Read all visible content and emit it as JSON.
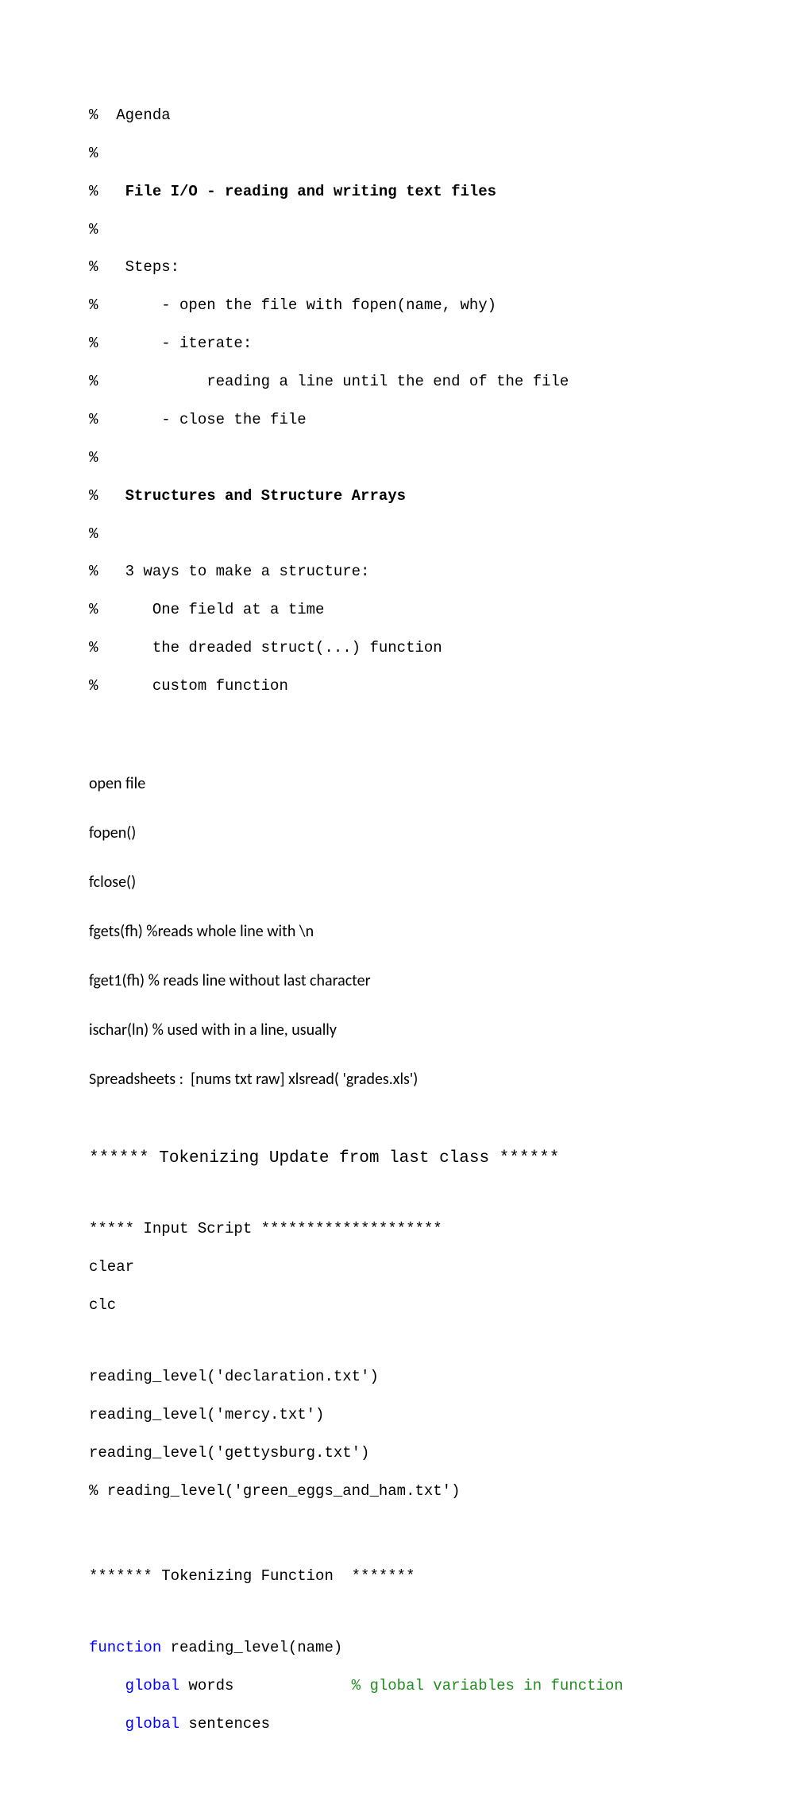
{
  "agenda": {
    "l1": "%  Agenda",
    "l2": "%",
    "l3_pre": "%   ",
    "l3_bold": "File I/O - reading and writing text files",
    "l4": "%",
    "l5": "%   Steps:",
    "l6": "%       - open the file with fopen(name, why)",
    "l7": "%       - iterate:",
    "l8": "%            reading a line until the end of the file",
    "l9": "%       - close the file",
    "l10": "%",
    "l11_pre": "%   ",
    "l11_bold": "Structures and Structure Arrays",
    "l12": "%",
    "l13": "%   3 ways to make a structure:",
    "l14": "%      One field at a time",
    "l15": "%      the dreaded struct(...) function",
    "l16": "%      custom function"
  },
  "notes": {
    "n1": "open file",
    "n2": "fopen()",
    "n3": "fclose()",
    "n4": "fgets(fh) %reads whole line with \\n",
    "n5": "fget1(fh) % reads line without last character",
    "n6": "ischar(ln) % used with in a line, usually",
    "n7": "Spreadsheets :  [nums txt raw] xlsread( 'grades.xls')"
  },
  "sections": {
    "tok_update": "****** Tokenizing Update from last class ******",
    "input_script": "***** Input Script ********************",
    "tok_func": "******* Tokenizing Function  *******"
  },
  "script": {
    "s1": "clear",
    "s2": "clc",
    "s3": "reading_level('declaration.txt')",
    "s4": "reading_level('mercy.txt')",
    "s5": "reading_level('gettysburg.txt')",
    "s6": "% reading_level('green_eggs_and_ham.txt')"
  },
  "func": {
    "f1_kw": "function",
    "f1_rest": " reading_level(name)",
    "f2_pre": "    ",
    "f2_kw": "global",
    "f2_mid": " words             ",
    "f2_cmt": "% global variables in function",
    "f3_pre": "    ",
    "f3_kw": "global",
    "f3_rest": " sentences"
  }
}
